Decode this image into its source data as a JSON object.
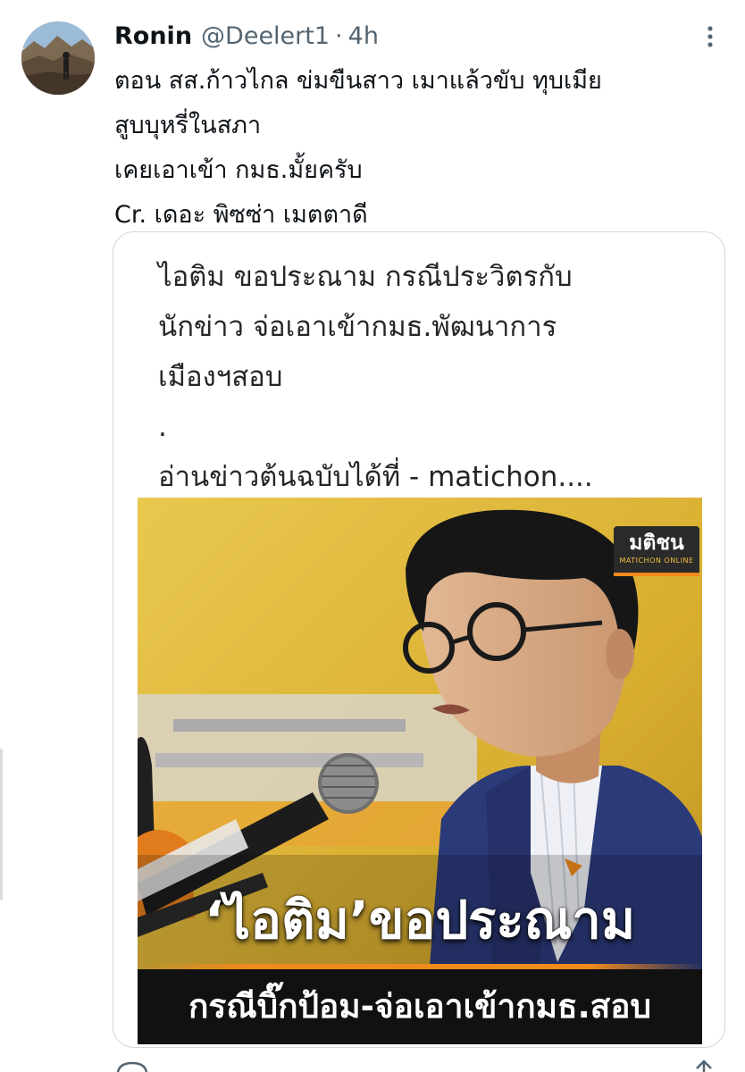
{
  "tweet": {
    "author_name": "Ronin",
    "author_handle": "@Deelert1",
    "separator": "·",
    "timestamp": "4h",
    "avatar_icon": "profile-photo-icon",
    "more_icon": "more-options-icon",
    "text_lines": [
      "ตอน สส.ก้าวไกล ข่มขืนสาว  เมาแล้วขับ ทุบเมีย",
      "สูบบุหรี่ในสภา",
      "เคยเอาเข้า กมธ.มั้ยครับ",
      "Cr. เดอะ พิซซ่า เมตตาดี"
    ]
  },
  "card": {
    "text_lines": [
      "ไอติม ขอประณาม กรณีประวิตรกับ",
      "นักข่าว จ่อเอาเข้ากมธ.พัฒนาการ",
      "เมืองฯสอบ",
      ".",
      "อ่านข่าวต้นฉบับได้ที่ - matichon...."
    ],
    "image": {
      "logo_main": "มติชน",
      "logo_sub": "MATICHON ONLINE",
      "headline": "‘ไอติม’ขอประณาม",
      "subheadline": "กรณีบิ๊กป้อม-จ่อเอาเข้ากมธ.สอบ"
    }
  },
  "colors": {
    "text_primary": "#0f1419",
    "text_secondary": "#536471",
    "card_border": "#cfd9de",
    "image_background": "#e0b73a",
    "brand_orange": "#f08a1c",
    "jacket_blue": "#2b3a78"
  }
}
